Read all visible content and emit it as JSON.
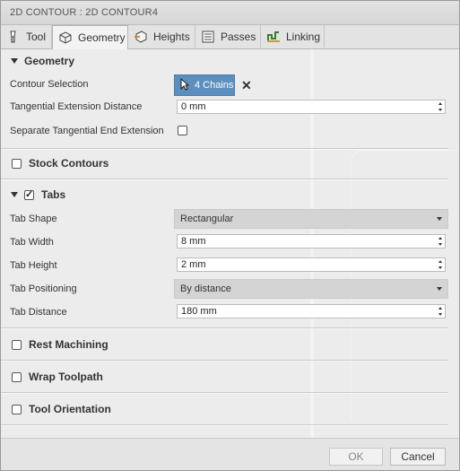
{
  "window": {
    "title": "2D CONTOUR : 2D CONTOUR4"
  },
  "tabs": [
    {
      "label": "Tool",
      "icon": "tool-icon"
    },
    {
      "label": "Geometry",
      "icon": "geometry-icon",
      "active": true
    },
    {
      "label": "Heights",
      "icon": "heights-icon"
    },
    {
      "label": "Passes",
      "icon": "passes-icon"
    },
    {
      "label": "Linking",
      "icon": "linking-icon"
    }
  ],
  "geometry": {
    "heading": "Geometry",
    "contour_selection_label": "Contour Selection",
    "chains_button": "4 Chains",
    "tangential_extension_label": "Tangential Extension Distance",
    "tangential_extension_value": "0 mm",
    "separate_tangential_label": "Separate Tangential End Extension",
    "separate_tangential_checked": false
  },
  "stock_contours": {
    "heading": "Stock Contours",
    "checked": false
  },
  "tabs_section": {
    "heading": "Tabs",
    "checked": true,
    "tab_shape_label": "Tab Shape",
    "tab_shape_value": "Rectangular",
    "tab_width_label": "Tab Width",
    "tab_width_value": "8 mm",
    "tab_height_label": "Tab Height",
    "tab_height_value": "2 mm",
    "tab_positioning_label": "Tab Positioning",
    "tab_positioning_value": "By distance",
    "tab_distance_label": "Tab Distance",
    "tab_distance_value": "180 mm"
  },
  "rest_machining": {
    "heading": "Rest Machining",
    "checked": false
  },
  "wrap_toolpath": {
    "heading": "Wrap Toolpath",
    "checked": false
  },
  "tool_orientation": {
    "heading": "Tool Orientation",
    "checked": false
  },
  "footer": {
    "ok_label": "OK",
    "cancel_label": "Cancel"
  },
  "colors": {
    "accent": "#5d8fbe",
    "background": "#ececec"
  }
}
